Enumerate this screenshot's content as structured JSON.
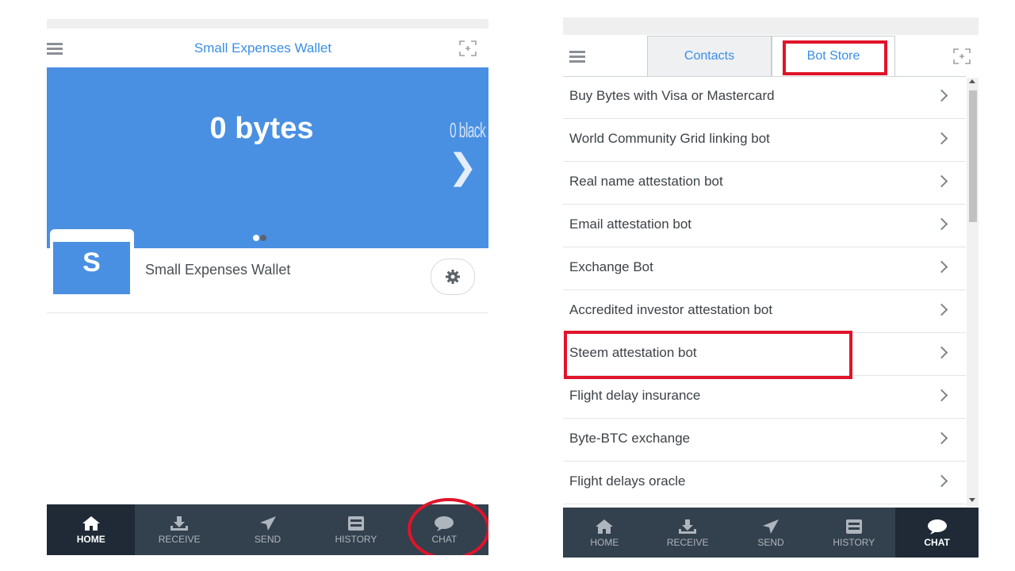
{
  "left_screen": {
    "header": {
      "title": "Small Expenses Wallet"
    },
    "balance": {
      "amount": "0 bytes",
      "secondary": "0 black"
    },
    "wallet": {
      "avatar_letter": "S",
      "name": "Small Expenses Wallet"
    },
    "nav": [
      {
        "label": "HOME",
        "icon": "home-icon",
        "active": true
      },
      {
        "label": "RECEIVE",
        "icon": "receive-icon",
        "active": false
      },
      {
        "label": "SEND",
        "icon": "send-icon",
        "active": false
      },
      {
        "label": "HISTORY",
        "icon": "history-icon",
        "active": false
      },
      {
        "label": "CHAT",
        "icon": "chat-icon",
        "active": false
      }
    ]
  },
  "right_screen": {
    "tabs": [
      {
        "label": "Contacts",
        "active": false
      },
      {
        "label": "Bot Store",
        "active": true
      }
    ],
    "bots": [
      "Buy Bytes with Visa or Mastercard",
      "World Community Grid linking bot",
      "Real name attestation bot",
      "Email attestation bot",
      "Exchange Bot",
      "Accredited investor attestation bot",
      "Steem attestation bot",
      "Flight delay insurance",
      "Byte-BTC exchange",
      "Flight delays oracle"
    ],
    "nav": [
      {
        "label": "HOME",
        "icon": "home-icon",
        "active": false
      },
      {
        "label": "RECEIVE",
        "icon": "receive-icon",
        "active": false
      },
      {
        "label": "SEND",
        "icon": "send-icon",
        "active": false
      },
      {
        "label": "HISTORY",
        "icon": "history-icon",
        "active": false
      },
      {
        "label": "CHAT",
        "icon": "chat-icon",
        "active": true
      }
    ]
  },
  "colors": {
    "accent": "#4a90e2",
    "nav_bg": "#33404d",
    "nav_active": "#1f2a36",
    "highlight": "#e0142a"
  }
}
